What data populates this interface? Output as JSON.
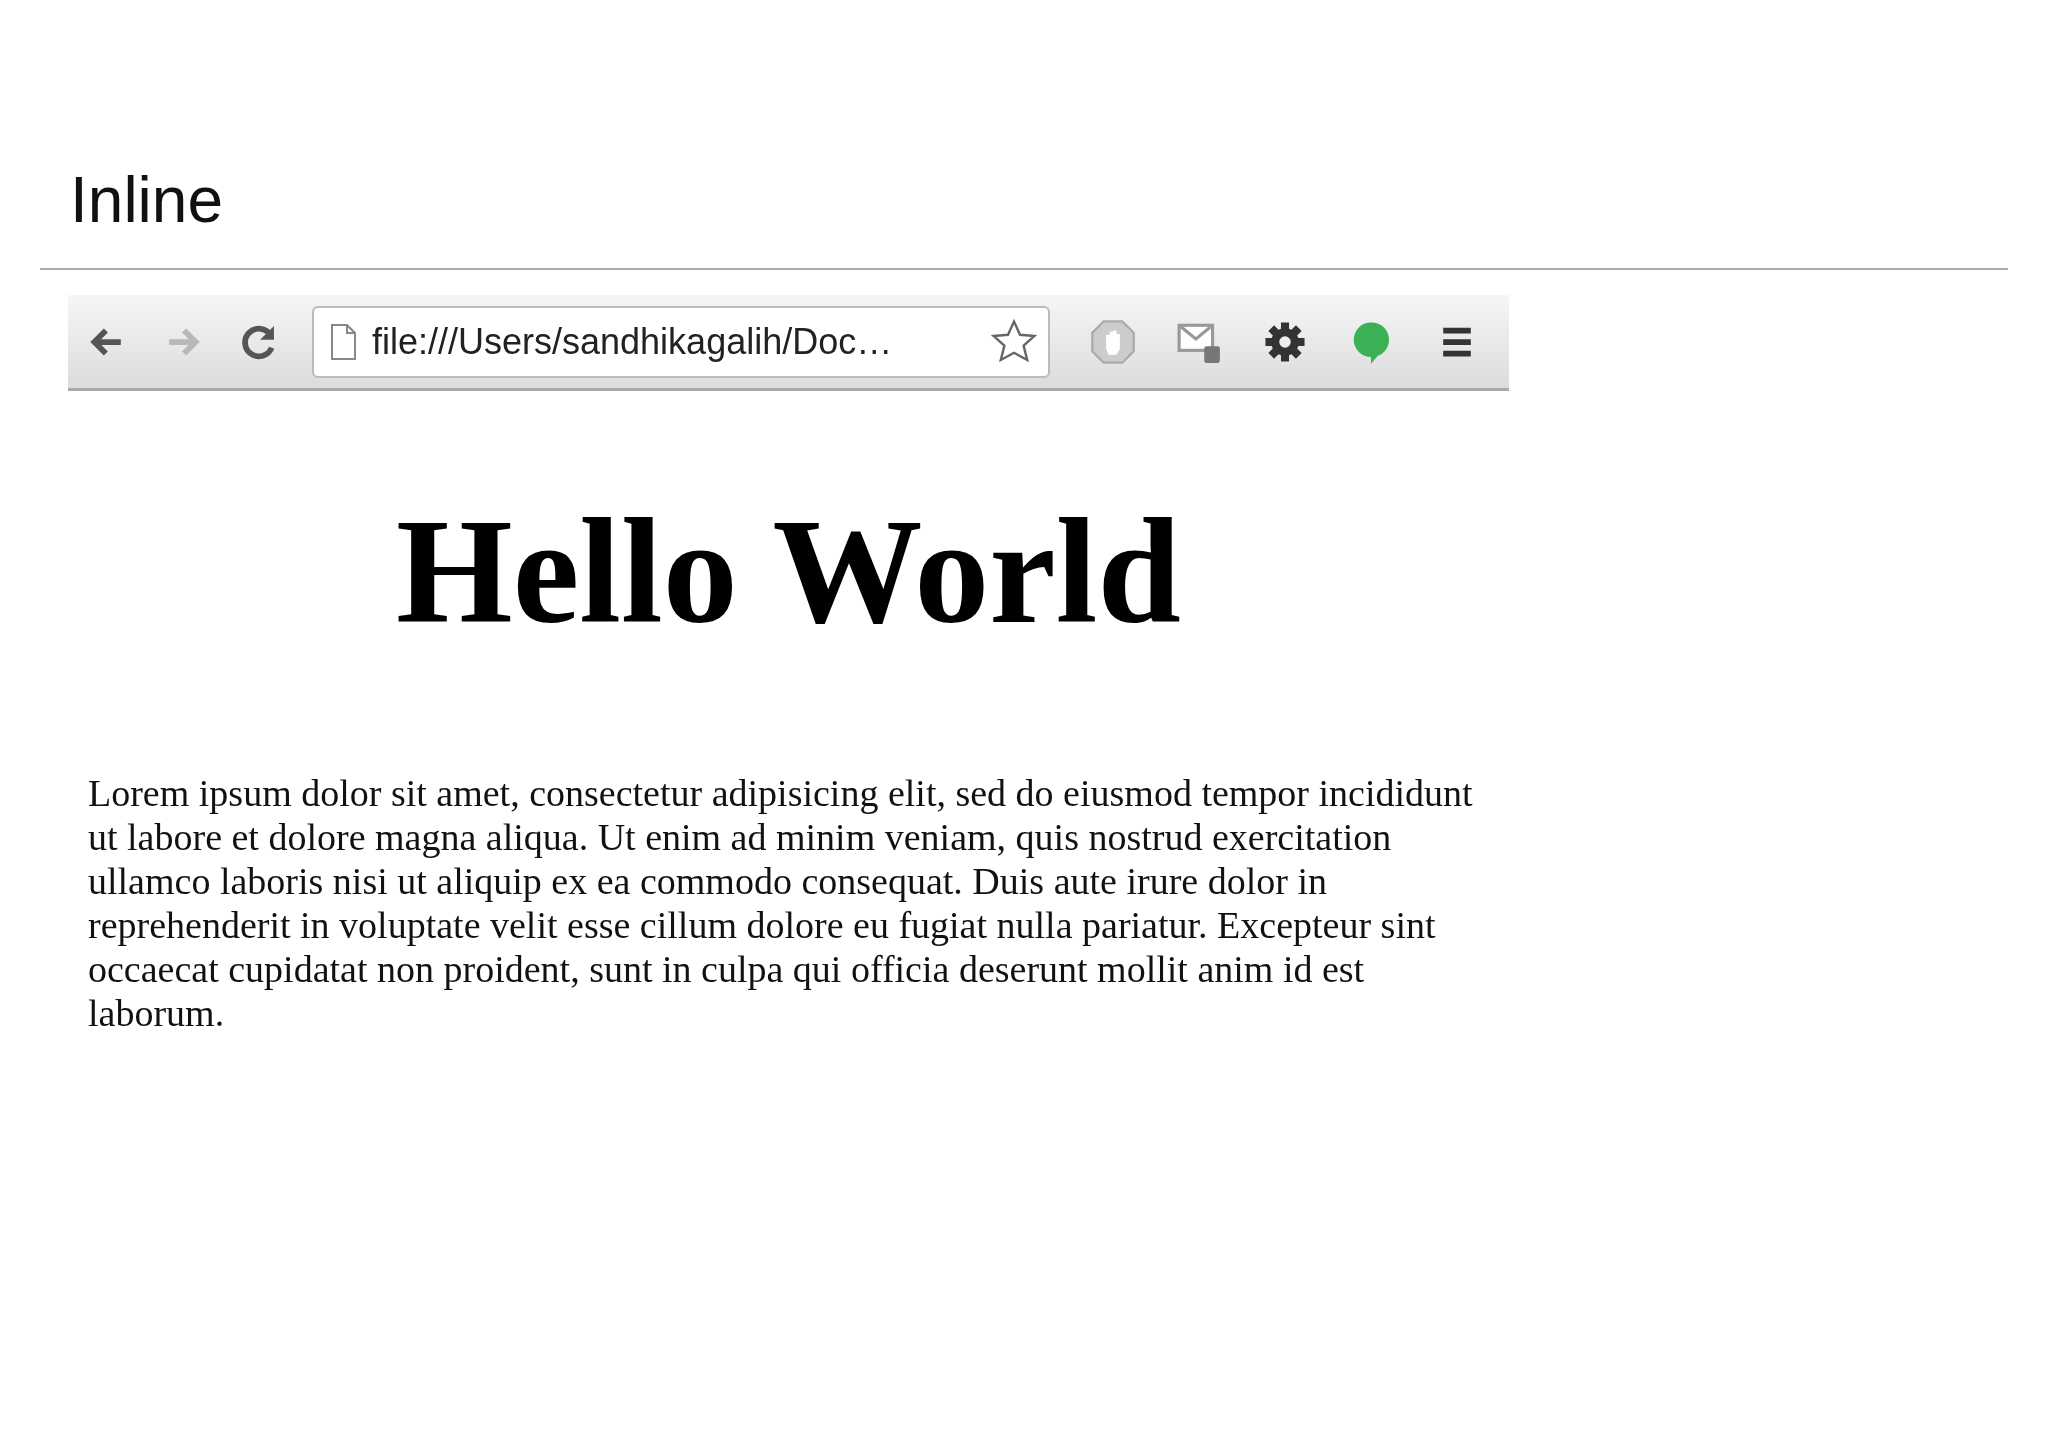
{
  "slide_title": "Inline",
  "browser": {
    "back_disabled": false,
    "forward_disabled": true,
    "url": "file:///Users/sandhikagalih/Doc…",
    "bookmarked": false
  },
  "page": {
    "heading": "Hello World",
    "paragraph": "Lorem ipsum dolor sit amet, consectetur adipisicing elit, sed do eiusmod tempor incididunt ut labore et dolore magna aliqua. Ut enim ad minim veniam, quis nostrud exercitation ullamco laboris nisi ut aliquip ex ea commodo consequat. Duis aute irure dolor in reprehenderit in voluptate velit esse cillum dolore eu fugiat nulla pariatur. Excepteur sint occaecat cupidatat non proident, sunt in culpa qui officia deserunt mollit anim id est laborum."
  }
}
